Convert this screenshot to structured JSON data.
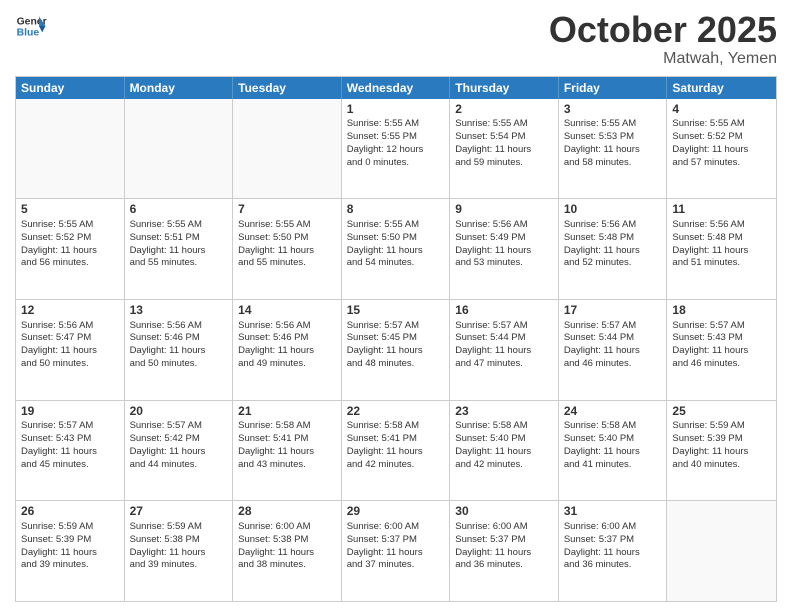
{
  "header": {
    "logo_line1": "General",
    "logo_line2": "Blue",
    "month": "October 2025",
    "location": "Matwah, Yemen"
  },
  "days_of_week": [
    "Sunday",
    "Monday",
    "Tuesday",
    "Wednesday",
    "Thursday",
    "Friday",
    "Saturday"
  ],
  "rows": [
    [
      {
        "day": "",
        "lines": []
      },
      {
        "day": "",
        "lines": []
      },
      {
        "day": "",
        "lines": []
      },
      {
        "day": "1",
        "lines": [
          "Sunrise: 5:55 AM",
          "Sunset: 5:55 PM",
          "Daylight: 12 hours",
          "and 0 minutes."
        ]
      },
      {
        "day": "2",
        "lines": [
          "Sunrise: 5:55 AM",
          "Sunset: 5:54 PM",
          "Daylight: 11 hours",
          "and 59 minutes."
        ]
      },
      {
        "day": "3",
        "lines": [
          "Sunrise: 5:55 AM",
          "Sunset: 5:53 PM",
          "Daylight: 11 hours",
          "and 58 minutes."
        ]
      },
      {
        "day": "4",
        "lines": [
          "Sunrise: 5:55 AM",
          "Sunset: 5:52 PM",
          "Daylight: 11 hours",
          "and 57 minutes."
        ]
      }
    ],
    [
      {
        "day": "5",
        "lines": [
          "Sunrise: 5:55 AM",
          "Sunset: 5:52 PM",
          "Daylight: 11 hours",
          "and 56 minutes."
        ]
      },
      {
        "day": "6",
        "lines": [
          "Sunrise: 5:55 AM",
          "Sunset: 5:51 PM",
          "Daylight: 11 hours",
          "and 55 minutes."
        ]
      },
      {
        "day": "7",
        "lines": [
          "Sunrise: 5:55 AM",
          "Sunset: 5:50 PM",
          "Daylight: 11 hours",
          "and 55 minutes."
        ]
      },
      {
        "day": "8",
        "lines": [
          "Sunrise: 5:55 AM",
          "Sunset: 5:50 PM",
          "Daylight: 11 hours",
          "and 54 minutes."
        ]
      },
      {
        "day": "9",
        "lines": [
          "Sunrise: 5:56 AM",
          "Sunset: 5:49 PM",
          "Daylight: 11 hours",
          "and 53 minutes."
        ]
      },
      {
        "day": "10",
        "lines": [
          "Sunrise: 5:56 AM",
          "Sunset: 5:48 PM",
          "Daylight: 11 hours",
          "and 52 minutes."
        ]
      },
      {
        "day": "11",
        "lines": [
          "Sunrise: 5:56 AM",
          "Sunset: 5:48 PM",
          "Daylight: 11 hours",
          "and 51 minutes."
        ]
      }
    ],
    [
      {
        "day": "12",
        "lines": [
          "Sunrise: 5:56 AM",
          "Sunset: 5:47 PM",
          "Daylight: 11 hours",
          "and 50 minutes."
        ]
      },
      {
        "day": "13",
        "lines": [
          "Sunrise: 5:56 AM",
          "Sunset: 5:46 PM",
          "Daylight: 11 hours",
          "and 50 minutes."
        ]
      },
      {
        "day": "14",
        "lines": [
          "Sunrise: 5:56 AM",
          "Sunset: 5:46 PM",
          "Daylight: 11 hours",
          "and 49 minutes."
        ]
      },
      {
        "day": "15",
        "lines": [
          "Sunrise: 5:57 AM",
          "Sunset: 5:45 PM",
          "Daylight: 11 hours",
          "and 48 minutes."
        ]
      },
      {
        "day": "16",
        "lines": [
          "Sunrise: 5:57 AM",
          "Sunset: 5:44 PM",
          "Daylight: 11 hours",
          "and 47 minutes."
        ]
      },
      {
        "day": "17",
        "lines": [
          "Sunrise: 5:57 AM",
          "Sunset: 5:44 PM",
          "Daylight: 11 hours",
          "and 46 minutes."
        ]
      },
      {
        "day": "18",
        "lines": [
          "Sunrise: 5:57 AM",
          "Sunset: 5:43 PM",
          "Daylight: 11 hours",
          "and 46 minutes."
        ]
      }
    ],
    [
      {
        "day": "19",
        "lines": [
          "Sunrise: 5:57 AM",
          "Sunset: 5:43 PM",
          "Daylight: 11 hours",
          "and 45 minutes."
        ]
      },
      {
        "day": "20",
        "lines": [
          "Sunrise: 5:57 AM",
          "Sunset: 5:42 PM",
          "Daylight: 11 hours",
          "and 44 minutes."
        ]
      },
      {
        "day": "21",
        "lines": [
          "Sunrise: 5:58 AM",
          "Sunset: 5:41 PM",
          "Daylight: 11 hours",
          "and 43 minutes."
        ]
      },
      {
        "day": "22",
        "lines": [
          "Sunrise: 5:58 AM",
          "Sunset: 5:41 PM",
          "Daylight: 11 hours",
          "and 42 minutes."
        ]
      },
      {
        "day": "23",
        "lines": [
          "Sunrise: 5:58 AM",
          "Sunset: 5:40 PM",
          "Daylight: 11 hours",
          "and 42 minutes."
        ]
      },
      {
        "day": "24",
        "lines": [
          "Sunrise: 5:58 AM",
          "Sunset: 5:40 PM",
          "Daylight: 11 hours",
          "and 41 minutes."
        ]
      },
      {
        "day": "25",
        "lines": [
          "Sunrise: 5:59 AM",
          "Sunset: 5:39 PM",
          "Daylight: 11 hours",
          "and 40 minutes."
        ]
      }
    ],
    [
      {
        "day": "26",
        "lines": [
          "Sunrise: 5:59 AM",
          "Sunset: 5:39 PM",
          "Daylight: 11 hours",
          "and 39 minutes."
        ]
      },
      {
        "day": "27",
        "lines": [
          "Sunrise: 5:59 AM",
          "Sunset: 5:38 PM",
          "Daylight: 11 hours",
          "and 39 minutes."
        ]
      },
      {
        "day": "28",
        "lines": [
          "Sunrise: 6:00 AM",
          "Sunset: 5:38 PM",
          "Daylight: 11 hours",
          "and 38 minutes."
        ]
      },
      {
        "day": "29",
        "lines": [
          "Sunrise: 6:00 AM",
          "Sunset: 5:37 PM",
          "Daylight: 11 hours",
          "and 37 minutes."
        ]
      },
      {
        "day": "30",
        "lines": [
          "Sunrise: 6:00 AM",
          "Sunset: 5:37 PM",
          "Daylight: 11 hours",
          "and 36 minutes."
        ]
      },
      {
        "day": "31",
        "lines": [
          "Sunrise: 6:00 AM",
          "Sunset: 5:37 PM",
          "Daylight: 11 hours",
          "and 36 minutes."
        ]
      },
      {
        "day": "",
        "lines": []
      }
    ]
  ]
}
